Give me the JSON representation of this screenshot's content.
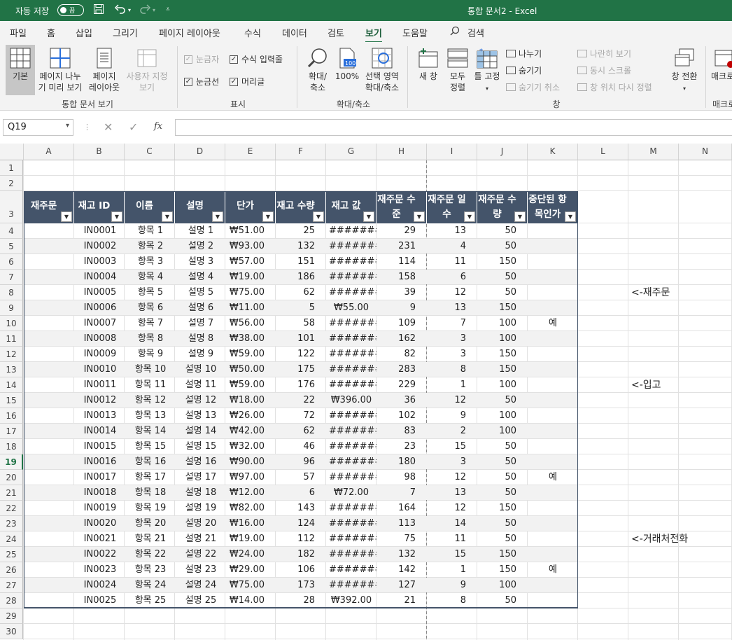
{
  "titlebar": {
    "autosave_label": "자동 저장",
    "toggle_label": "끔",
    "doc_title": "통합 문서2 - Excel",
    "icons": [
      "save-icon",
      "undo-icon",
      "redo-icon",
      "customize-icon"
    ]
  },
  "menu": {
    "tabs": [
      "파일",
      "홈",
      "삽입",
      "그리기",
      "페이지 레이아웃",
      "수식",
      "데이터",
      "검토",
      "보기",
      "도움말",
      "검색"
    ],
    "active": "보기"
  },
  "ribbon": {
    "views": {
      "normal": "기본",
      "pagebreak_l1": "페이지 나누",
      "pagebreak_l2": "기 미리 보기",
      "pagelayout_l1": "페이지",
      "pagelayout_l2": "레이아웃",
      "custom_l1": "사용자 지정",
      "custom_l2": "보기",
      "group": "통합 문서 보기"
    },
    "show": {
      "ruler": "눈금자",
      "formula_bar": "수식 입력줄",
      "gridlines": "눈금선",
      "headings": "머리글",
      "group": "표시"
    },
    "zoom": {
      "zoom_l1": "확대/",
      "zoom_l2": "축소",
      "zoom100": "100%",
      "zoomsel_l1": "선택 영역",
      "zoomsel_l2": "확대/축소",
      "icon_label": "100",
      "group": "확대/축소"
    },
    "window": {
      "new": "새 창",
      "arrange_l1": "모두",
      "arrange_l2": "정렬",
      "freeze": "틀 고정",
      "split": "나누기",
      "hide": "숨기기",
      "unhide": "숨기기 취소",
      "side": "나란히 보기",
      "sync": "동시 스크롤",
      "reset": "창 위치 다시 정렬",
      "switch": "창 전환",
      "macro": "매크로",
      "group": "창",
      "group2": "매크로"
    }
  },
  "formula": {
    "namebox": "Q19",
    "fx": "fx",
    "value": ""
  },
  "sheet": {
    "columns": [
      "A",
      "B",
      "C",
      "D",
      "E",
      "F",
      "G",
      "H",
      "I",
      "J",
      "K",
      "L",
      "M",
      "N"
    ],
    "rows": [
      "1",
      "2",
      "3",
      "4",
      "5",
      "6",
      "7",
      "8",
      "9",
      "10",
      "11",
      "12",
      "13",
      "14",
      "15",
      "16",
      "17",
      "18",
      "19",
      "20",
      "21",
      "22",
      "23",
      "24",
      "25",
      "26",
      "27",
      "28",
      "29",
      "30"
    ],
    "selected_row": "19",
    "headers": [
      "재주문",
      "재고 ID",
      "이름",
      "설명",
      "단가",
      "재고 수량",
      "재고 값",
      "재주문 수준",
      "재주문 일수",
      "재주문 수량",
      "중단된 항목인가"
    ],
    "headers_display": [
      [
        "재주문"
      ],
      [
        "재고 ID"
      ],
      [
        "이름"
      ],
      [
        "설명"
      ],
      [
        "단가"
      ],
      [
        "재고 수량"
      ],
      [
        "재고 값"
      ],
      [
        "재주문 수",
        "준"
      ],
      [
        "재주문 일",
        "수"
      ],
      [
        "재주문 수",
        "량"
      ],
      [
        "중단된 항",
        "목인가"
      ]
    ],
    "data": [
      [
        "",
        "IN0001",
        "항목 1",
        "설명 1",
        "₩51.00",
        "25",
        "########",
        "29",
        "13",
        "50",
        ""
      ],
      [
        "",
        "IN0002",
        "항목 2",
        "설명 2",
        "₩93.00",
        "132",
        "########",
        "231",
        "4",
        "50",
        ""
      ],
      [
        "",
        "IN0003",
        "항목 3",
        "설명 3",
        "₩57.00",
        "151",
        "########",
        "114",
        "11",
        "150",
        ""
      ],
      [
        "",
        "IN0004",
        "항목 4",
        "설명 4",
        "₩19.00",
        "186",
        "########",
        "158",
        "6",
        "50",
        ""
      ],
      [
        "",
        "IN0005",
        "항목 5",
        "설명 5",
        "₩75.00",
        "62",
        "########",
        "39",
        "12",
        "50",
        ""
      ],
      [
        "",
        "IN0006",
        "항목 6",
        "설명 6",
        "₩11.00",
        "5",
        "₩55.00",
        "9",
        "13",
        "150",
        ""
      ],
      [
        "",
        "IN0007",
        "항목 7",
        "설명 7",
        "₩56.00",
        "58",
        "########",
        "109",
        "7",
        "100",
        "예"
      ],
      [
        "",
        "IN0008",
        "항목 8",
        "설명 8",
        "₩38.00",
        "101",
        "########",
        "162",
        "3",
        "100",
        ""
      ],
      [
        "",
        "IN0009",
        "항목 9",
        "설명 9",
        "₩59.00",
        "122",
        "########",
        "82",
        "3",
        "150",
        ""
      ],
      [
        "",
        "IN0010",
        "항목 10",
        "설명 10",
        "₩50.00",
        "175",
        "########",
        "283",
        "8",
        "150",
        ""
      ],
      [
        "",
        "IN0011",
        "항목 11",
        "설명 11",
        "₩59.00",
        "176",
        "########",
        "229",
        "1",
        "100",
        ""
      ],
      [
        "",
        "IN0012",
        "항목 12",
        "설명 12",
        "₩18.00",
        "22",
        "₩396.00",
        "36",
        "12",
        "50",
        ""
      ],
      [
        "",
        "IN0013",
        "항목 13",
        "설명 13",
        "₩26.00",
        "72",
        "########",
        "102",
        "9",
        "100",
        ""
      ],
      [
        "",
        "IN0014",
        "항목 14",
        "설명 14",
        "₩42.00",
        "62",
        "########",
        "83",
        "2",
        "100",
        ""
      ],
      [
        "",
        "IN0015",
        "항목 15",
        "설명 15",
        "₩32.00",
        "46",
        "########",
        "23",
        "15",
        "50",
        ""
      ],
      [
        "",
        "IN0016",
        "항목 16",
        "설명 16",
        "₩90.00",
        "96",
        "########",
        "180",
        "3",
        "50",
        ""
      ],
      [
        "",
        "IN0017",
        "항목 17",
        "설명 17",
        "₩97.00",
        "57",
        "########",
        "98",
        "12",
        "50",
        "예"
      ],
      [
        "",
        "IN0018",
        "항목 18",
        "설명 18",
        "₩12.00",
        "6",
        "₩72.00",
        "7",
        "13",
        "50",
        ""
      ],
      [
        "",
        "IN0019",
        "항목 19",
        "설명 19",
        "₩82.00",
        "143",
        "########",
        "164",
        "12",
        "150",
        ""
      ],
      [
        "",
        "IN0020",
        "항목 20",
        "설명 20",
        "₩16.00",
        "124",
        "########",
        "113",
        "14",
        "50",
        ""
      ],
      [
        "",
        "IN0021",
        "항목 21",
        "설명 21",
        "₩19.00",
        "112",
        "########",
        "75",
        "11",
        "50",
        ""
      ],
      [
        "",
        "IN0022",
        "항목 22",
        "설명 22",
        "₩24.00",
        "182",
        "########",
        "132",
        "15",
        "150",
        ""
      ],
      [
        "",
        "IN0023",
        "항목 23",
        "설명 23",
        "₩29.00",
        "106",
        "########",
        "142",
        "1",
        "150",
        "예"
      ],
      [
        "",
        "IN0024",
        "항목 24",
        "설명 24",
        "₩75.00",
        "173",
        "########",
        "127",
        "9",
        "100",
        ""
      ],
      [
        "",
        "IN0025",
        "항목 25",
        "설명 25",
        "₩14.00",
        "28",
        "₩392.00",
        "21",
        "8",
        "50",
        ""
      ]
    ],
    "notes": [
      {
        "row": "8",
        "text": "<-재주문"
      },
      {
        "row": "14",
        "text": "<-입고"
      },
      {
        "row": "24",
        "text": "<-거래처전화"
      }
    ],
    "colors": {
      "header_bg": "#44546a",
      "band": "#f2f2f2",
      "accent": "#217346"
    }
  }
}
